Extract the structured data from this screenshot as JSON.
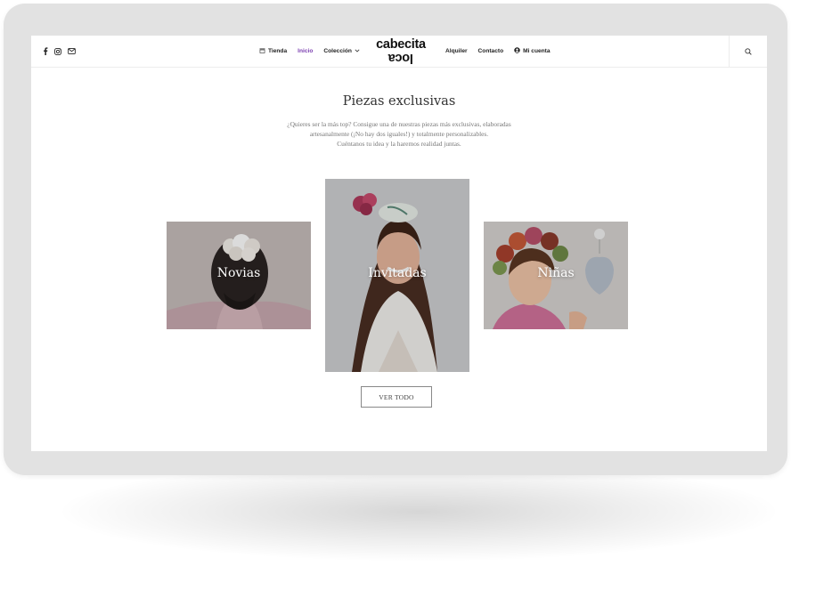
{
  "nav": {
    "left_items": [
      {
        "label": "Tienda",
        "icon": "store-icon"
      },
      {
        "label": "Inicio",
        "active": true
      },
      {
        "label": "Colección",
        "has_dropdown": true
      }
    ],
    "right_items": [
      {
        "label": "Alquiler"
      },
      {
        "label": "Contacto"
      },
      {
        "label": "Mi cuenta",
        "icon": "user-icon"
      }
    ],
    "social_icons": [
      "facebook-icon",
      "instagram-icon",
      "mail-icon"
    ],
    "search_icon": "search-icon"
  },
  "logo": {
    "line1": "cabecita",
    "line2": "loca"
  },
  "section": {
    "title": "Piezas exclusivas",
    "intro_lines": [
      "¿Quieres ser la más top? Consigue una de nuestras piezas más exclusivas, elaboradas",
      "artesanalmente (¡No hay dos iguales!) y totalmente personalizables.",
      "Cuéntanos tu idea y la haremos realidad juntas."
    ]
  },
  "categories": [
    {
      "label": "Novias"
    },
    {
      "label": "Invitadas"
    },
    {
      "label": "Niñas"
    }
  ],
  "cta": {
    "label": "VER TODO"
  },
  "colors": {
    "accent": "#7b3fb0",
    "device_frame": "#e2e2e2",
    "text_dark": "#333333"
  }
}
